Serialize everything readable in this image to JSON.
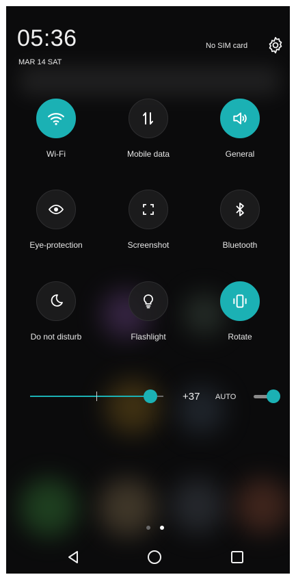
{
  "status": {
    "time": "05:36",
    "date": "MAR 14 SAT",
    "sim": "No SIM card"
  },
  "toggles": [
    {
      "label": "Wi-Fi",
      "icon": "wifi-icon",
      "on": true
    },
    {
      "label": "Mobile data",
      "icon": "mobile-data-icon",
      "on": false
    },
    {
      "label": "General",
      "icon": "sound-icon",
      "on": true
    },
    {
      "label": "Eye-protection",
      "icon": "eye-icon",
      "on": false
    },
    {
      "label": "Screenshot",
      "icon": "screenshot-icon",
      "on": false
    },
    {
      "label": "Bluetooth",
      "icon": "bluetooth-icon",
      "on": false
    },
    {
      "label": "Do not disturb",
      "icon": "moon-icon",
      "on": false
    },
    {
      "label": "Flashlight",
      "icon": "bulb-icon",
      "on": false
    },
    {
      "label": "Rotate",
      "icon": "rotate-icon",
      "on": true
    }
  ],
  "brightness": {
    "value_label": "+37",
    "level": 0.9,
    "auto_label": "AUTO",
    "auto_on": true
  },
  "pager": {
    "pages": 2,
    "current": 2
  },
  "colors": {
    "accent": "#1bb1b4",
    "background": "#0b0b0c"
  }
}
